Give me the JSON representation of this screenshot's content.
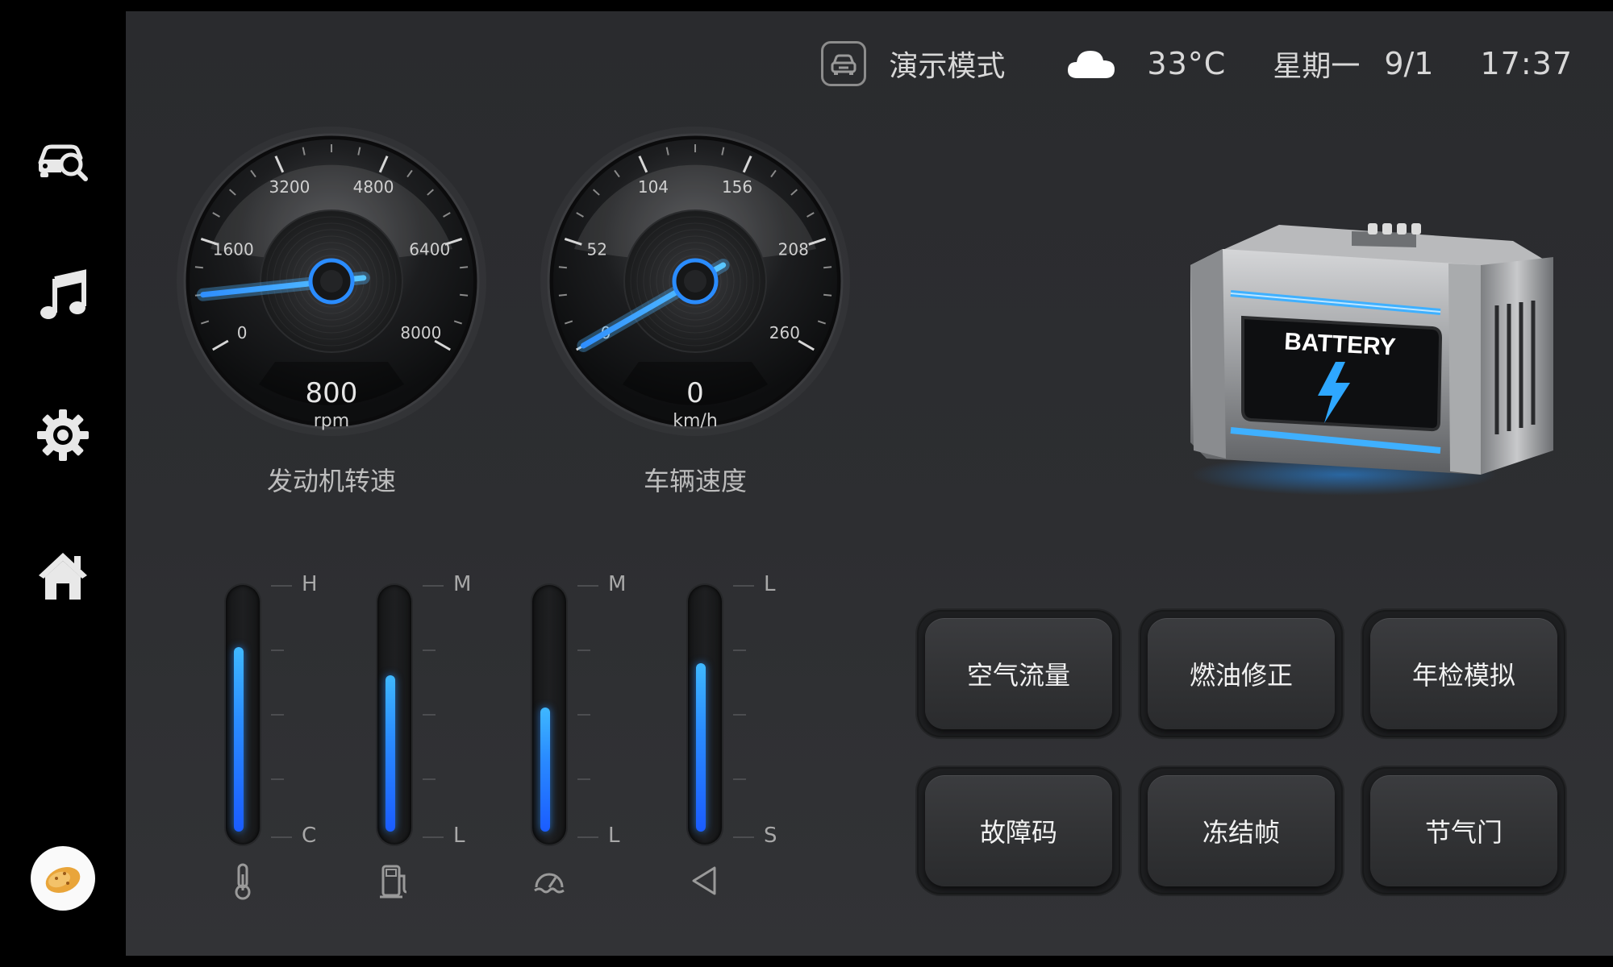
{
  "sidebar": {
    "items": [
      {
        "name": "car-diagnostic",
        "icon": "car-search-icon"
      },
      {
        "name": "music",
        "icon": "music-note-icon"
      },
      {
        "name": "settings",
        "icon": "gear-icon"
      },
      {
        "name": "home",
        "icon": "home-icon"
      }
    ],
    "avatar_icon": "potato-avatar-icon"
  },
  "status": {
    "mode_icon": "car-front-icon",
    "mode_label": "演示模式",
    "weather_icon": "cloud-icon",
    "temperature": "33°C",
    "weekday": "星期一",
    "date": "9/1",
    "time": "17:37"
  },
  "gauges": {
    "rpm": {
      "caption": "发动机转速",
      "value": "800",
      "unit": "rpm",
      "ticks": [
        "0",
        "1600",
        "3200",
        "4800",
        "6400",
        "8000"
      ],
      "needle_value": 800,
      "max": 8000
    },
    "speed": {
      "caption": "车辆速度",
      "value": "0",
      "unit": "km/h",
      "ticks": [
        "0",
        "52",
        "104",
        "156",
        "208",
        "260"
      ],
      "needle_value": 0,
      "max": 260
    }
  },
  "bars": [
    {
      "name": "coolant-temp",
      "high": "H",
      "low": "C",
      "icon": "thermometer-icon",
      "level": 0.79
    },
    {
      "name": "fuel",
      "high": "M",
      "low": "L",
      "icon": "fuel-pump-icon",
      "level": 0.67
    },
    {
      "name": "load",
      "high": "M",
      "low": "L",
      "icon": "gauge-icon",
      "level": 0.53
    },
    {
      "name": "throttle",
      "high": "L",
      "low": "S",
      "icon": "triangle-left-icon",
      "level": 0.72
    }
  ],
  "battery": {
    "label": "BATTERY",
    "icon": "lightning-bolt-icon"
  },
  "actions": [
    {
      "label": "空气流量"
    },
    {
      "label": "燃油修正"
    },
    {
      "label": "年检模拟"
    },
    {
      "label": "故障码"
    },
    {
      "label": "冻结帧"
    },
    {
      "label": "节气门"
    }
  ],
  "colors": {
    "accent": "#2a8cff",
    "accent_light": "#3fb8ff",
    "panel": "#2c2d30"
  }
}
